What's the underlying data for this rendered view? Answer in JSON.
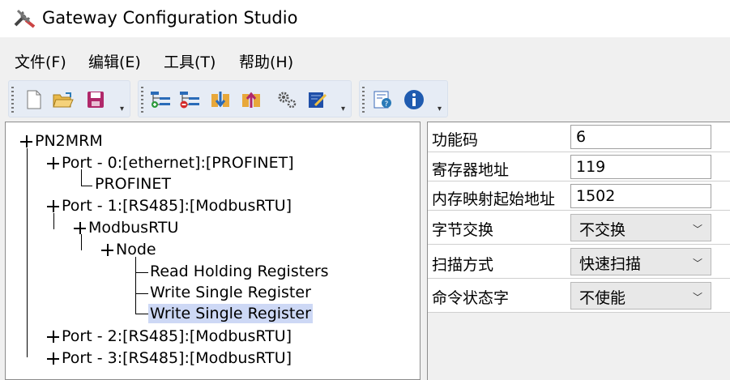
{
  "window": {
    "title": "Gateway Configuration Studio",
    "icon": "tools-icon"
  },
  "menu": [
    "文件(F)",
    "编辑(E)",
    "工具(T)",
    "帮助(H)"
  ],
  "toolbar": {
    "groups": [
      [
        "new-file-icon",
        "open-folder-icon",
        "save-icon"
      ],
      [
        "add-node-icon",
        "delete-node-icon",
        "download-icon",
        "upload-icon",
        "settings-gear-icon",
        "edit-note-icon"
      ],
      [
        "report-help-icon",
        "info-icon"
      ]
    ]
  },
  "tree": {
    "root": "PN2MRM",
    "port0": "Port - 0:[ethernet]:[PROFINET]",
    "port0_child": "PROFINET",
    "port1": "Port - 1:[RS485]:[ModbusRTU]",
    "port1_protocol": "ModbusRTU",
    "node": "Node",
    "cmd1": "Read Holding Registers",
    "cmd2": "Write Single Register",
    "cmd3": "Write Single Register",
    "port2": "Port - 2:[RS485]:[ModbusRTU]",
    "port3": "Port - 3:[RS485]:[ModbusRTU]",
    "selected": "cmd3"
  },
  "properties": {
    "function_code": {
      "label": "功能码",
      "value": "6"
    },
    "register_address": {
      "label": "寄存器地址",
      "value": "119"
    },
    "memory_map_start": {
      "label": "内存映射起始地址",
      "value": "1502"
    },
    "byte_swap": {
      "label": "字节交换",
      "value": "不交换"
    },
    "scan_mode": {
      "label": "扫描方式",
      "value": "快速扫描"
    },
    "command_status": {
      "label": "命令状态字",
      "value": "不使能"
    }
  },
  "colors": {
    "selection": "#cdd8f5",
    "toolbar_bg": "#e6ecf5"
  }
}
